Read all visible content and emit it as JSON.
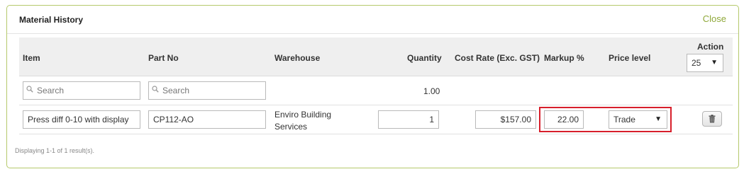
{
  "panel": {
    "title": "Material History",
    "close_label": "Close"
  },
  "columns": {
    "item": "Item",
    "part_no": "Part No",
    "warehouse": "Warehouse",
    "quantity": "Quantity",
    "cost_rate": "Cost Rate (Exc. GST)",
    "markup": "Markup %",
    "price_level": "Price level",
    "action": "Action"
  },
  "page_size": {
    "selected": "25"
  },
  "search": {
    "item_placeholder": "Search",
    "part_no_placeholder": "Search",
    "quantity_total": "1.00"
  },
  "rows": [
    {
      "item": "Press diff 0-10 with display",
      "part_no": "CP112-AO",
      "warehouse_line1": "Enviro Building",
      "warehouse_line2": "Services",
      "quantity": "1",
      "cost_rate": "$157.00",
      "markup": "22.00",
      "price_level": "Trade"
    }
  ],
  "footer": {
    "status": "Displaying 1-1 of 1 result(s)."
  },
  "colors": {
    "accent": "#8fa83a",
    "panel_border": "#b5c96b",
    "highlight": "#d71f2b"
  },
  "icons": {
    "search": "magnifier-icon",
    "delete": "trash-icon",
    "dropdown": "caret-down-icon"
  }
}
